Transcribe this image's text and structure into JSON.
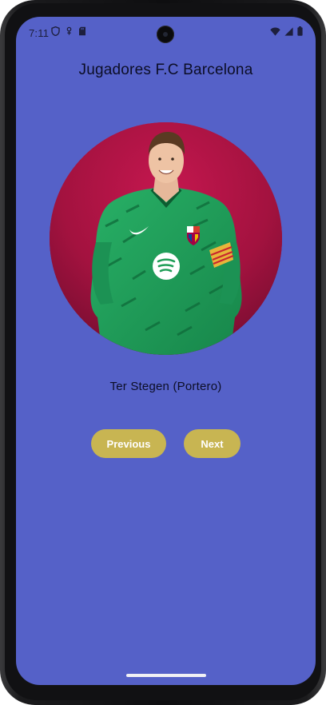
{
  "status_bar": {
    "time": "7:11",
    "left_icons": [
      "shield-icon",
      "location-icon",
      "sd-card-icon"
    ],
    "right_icons": [
      "wifi-icon",
      "signal-icon",
      "battery-icon"
    ]
  },
  "app": {
    "title": "Jugadores F.C Barcelona",
    "player_caption": "Ter Stegen (Portero)",
    "buttons": {
      "previous_label": "Previous",
      "next_label": "Next"
    }
  },
  "colors": {
    "background": "#5561c8",
    "button": "#c8b552",
    "photo_bg": "#a5123f",
    "jersey": "#1f9e57"
  }
}
